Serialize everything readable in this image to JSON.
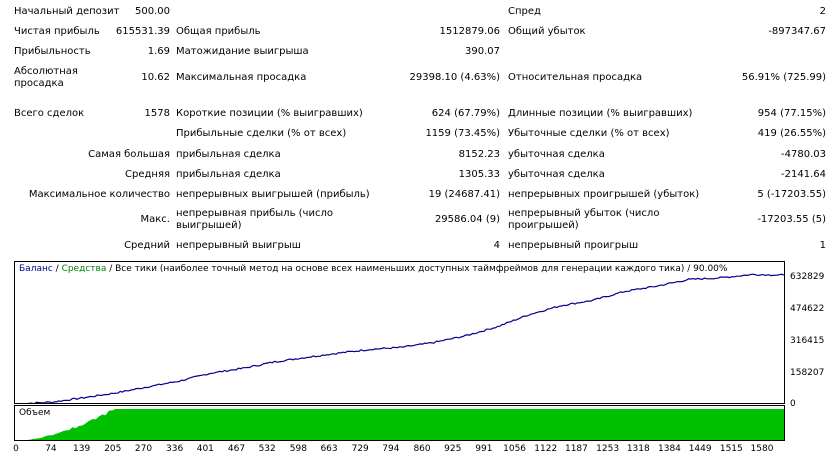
{
  "report": {
    "initial_deposit": {
      "label": "Начальный депозит",
      "value": "500.00"
    },
    "spread": {
      "label": "Спред",
      "value": "2"
    },
    "net_profit": {
      "label": "Чистая прибыль",
      "value": "615531.39"
    },
    "gross_profit": {
      "label": "Общая прибыль",
      "value": "1512879.06"
    },
    "gross_loss": {
      "label": "Общий убыток",
      "value": "-897347.67"
    },
    "profit_factor": {
      "label": "Прибыльность",
      "value": "1.69"
    },
    "expected_payoff": {
      "label": "Матожидание выигрыша",
      "value": "390.07"
    },
    "abs_drawdown": {
      "label": "Абсолютная просадка",
      "value": "10.62"
    },
    "max_drawdown": {
      "label": "Максимальная просадка",
      "value": "29398.10 (4.63%)"
    },
    "rel_drawdown": {
      "label": "Относительная просадка",
      "value": "56.91% (725.99)"
    },
    "total_trades": {
      "label": "Всего сделок",
      "value": "1578"
    },
    "short_positions": {
      "label": "Короткие позиции (% выигравших)",
      "value": "624 (67.79%)"
    },
    "long_positions": {
      "label": "Длинные позиции (% выигравших)",
      "value": "954 (77.15%)"
    },
    "profit_trades": {
      "label": "Прибыльные сделки (% от всех)",
      "value": "1159 (73.45%)"
    },
    "loss_trades": {
      "label": "Убыточные сделки (% от всех)",
      "value": "419 (26.55%)"
    },
    "largest": {
      "label": "Самая большая",
      "profit_label": "прибыльная сделка",
      "profit_value": "8152.23",
      "loss_label": "убыточная сделка",
      "loss_value": "-4780.03"
    },
    "average": {
      "label": "Средняя",
      "profit_label": "прибыльная сделка",
      "profit_value": "1305.33",
      "loss_label": "убыточная сделка",
      "loss_value": "-2141.64"
    },
    "max_consecutive": {
      "label": "Максимальное количество",
      "wins_label": "непрерывных выигрышей (прибыль)",
      "wins_value": "19 (24687.41)",
      "losses_label": "непрерывных проигрышей (убыток)",
      "losses_value": "5 (-17203.55)"
    },
    "max_cons_amount": {
      "label": "Макс.",
      "profit_label": "непрерывная прибыль (число выигрышей)",
      "profit_value": "29586.04 (9)",
      "loss_label": "непрерывный убыток (число проигрышей)",
      "loss_value": "-17203.55 (5)"
    },
    "avg_consecutive": {
      "label": "Средний",
      "wins_label": "непрерывный выигрыш",
      "wins_value": "4",
      "losses_label": "непрерывный проигрыш",
      "losses_value": "1"
    }
  },
  "chart": {
    "legend_balance": "Баланс",
    "legend_equity": "Средства",
    "legend_separator": " / ",
    "legend_desc": "Все тики (наиболее точный метод на основе всех наименьших доступных таймфреймов для генерации каждого тика)",
    "legend_quality": "/ 90.00%",
    "y_labels": [
      "632829",
      "474622",
      "316415",
      "158207",
      "0"
    ],
    "volume_label": "Объем",
    "x_labels": [
      "0",
      "74",
      "139",
      "205",
      "270",
      "336",
      "401",
      "467",
      "532",
      "598",
      "663",
      "729",
      "794",
      "860",
      "925",
      "991",
      "1056",
      "1122",
      "1187",
      "1253",
      "1318",
      "1384",
      "1449",
      "1515",
      "1580"
    ],
    "colors": {
      "balance": "#00008b",
      "equity": "#008000",
      "volume": "#00c000"
    }
  },
  "chart_data": {
    "type": "line",
    "title": "",
    "xlabel": "",
    "ylabel": "",
    "xlim": [
      0,
      1580
    ],
    "ylim": [
      0,
      632829
    ],
    "series": [
      {
        "name": "Баланс",
        "x": [
          0,
          74,
          139,
          205,
          270,
          336,
          401,
          467,
          532,
          598,
          663,
          729,
          794,
          860,
          925,
          991,
          1056,
          1122,
          1187,
          1253,
          1318,
          1384,
          1449,
          1515,
          1580
        ],
        "values": [
          500,
          9000,
          30000,
          53000,
          82000,
          110000,
          148000,
          171000,
          202000,
          224000,
          244000,
          262000,
          272000,
          295000,
          327000,
          371000,
          429000,
          472000,
          497000,
          540000,
          565000,
          597000,
          605000,
          621000,
          618000
        ]
      }
    ],
    "volume": {
      "name": "Объем",
      "full_from_trade": 205
    }
  }
}
